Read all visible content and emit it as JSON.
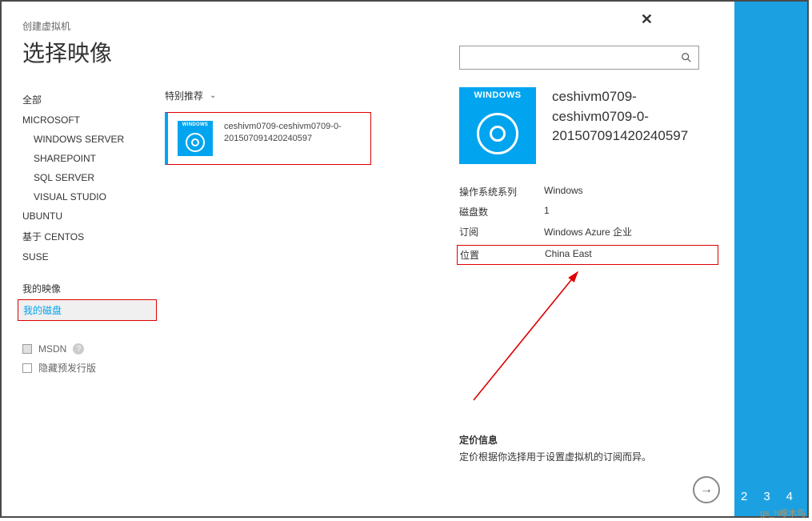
{
  "breadcrumb": "创建虚拟机",
  "page_title": "选择映像",
  "sidebar": {
    "all": "全部",
    "microsoft": "MICROSOFT",
    "windows_server": "WINDOWS SERVER",
    "sharepoint": "SHAREPOINT",
    "sql_server": "SQL SERVER",
    "visual_studio": "VISUAL STUDIO",
    "ubuntu": "UBUNTU",
    "centos": "基于 CENTOS",
    "suse": "SUSE",
    "my_images": "我的映像",
    "my_disks": "我的磁盘"
  },
  "options": {
    "msdn": "MSDN",
    "hide_prerelease": "隐藏预发行版"
  },
  "recommend_label": "特别推荐",
  "image_item": {
    "line1": "ceshivm0709-ceshivm0709-0-",
    "line2": "201507091420240597",
    "icon_text": "WINDOWS"
  },
  "search": {
    "placeholder": ""
  },
  "detail": {
    "icon_text": "WINDOWS",
    "title_l1": "ceshivm0709-",
    "title_l2": "ceshivm0709-0-",
    "title_l3": "201507091420240597",
    "props": {
      "os_label": "操作系统系列",
      "os_value": "Windows",
      "disks_label": "磁盘数",
      "disks_value": "1",
      "subscription_label": "订阅",
      "subscription_value": "Windows Azure 企业",
      "location_label": "位置",
      "location_value": "China East"
    },
    "pricing_title": "定价信息",
    "pricing_text": "定价根据你选择用于设置虚拟机的订阅而异。"
  },
  "steps": {
    "s2": "2",
    "s3": "3",
    "s4": "4"
  },
  "watermark": "gs_h啄木鸟"
}
